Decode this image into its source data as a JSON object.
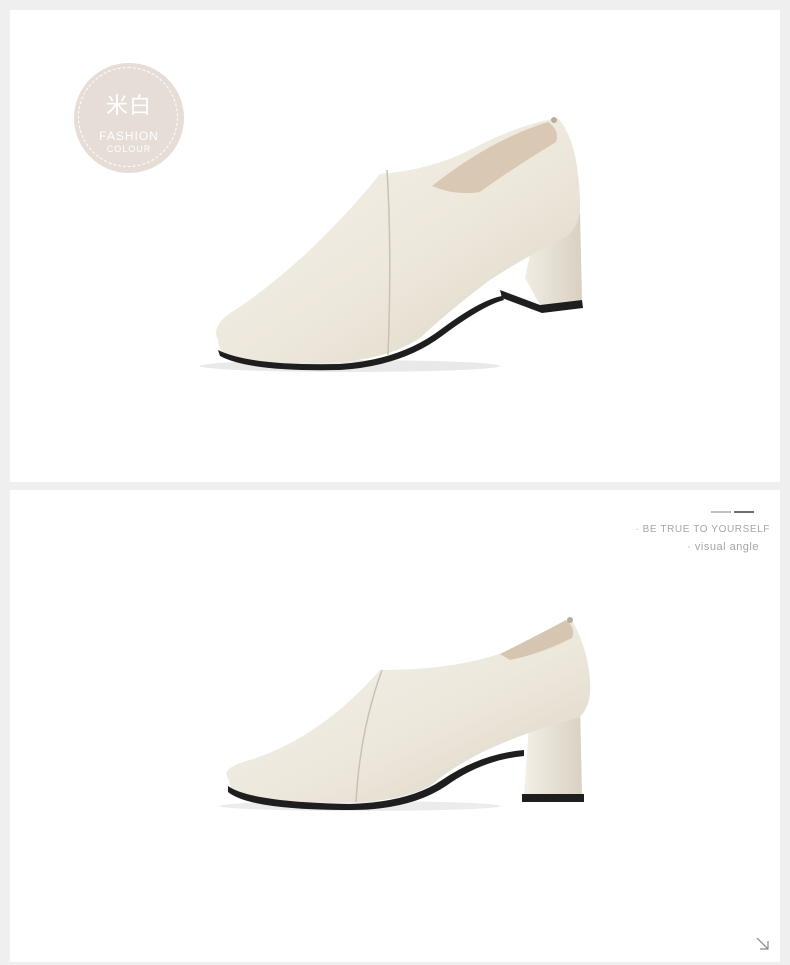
{
  "badge": {
    "title": "米白",
    "line1": "FASHION",
    "line2": "COLOUR"
  },
  "section2": {
    "tagline": "· BE TRUE TO YOURSELF",
    "subtitle": "· visual angle"
  },
  "icons": {
    "corner_arrow": "arrow-down-right-icon"
  },
  "colors": {
    "badge_bg": "#e6ddd6",
    "shoe_leather": "#ece7dc",
    "text_gray": "#a6a6a6"
  }
}
